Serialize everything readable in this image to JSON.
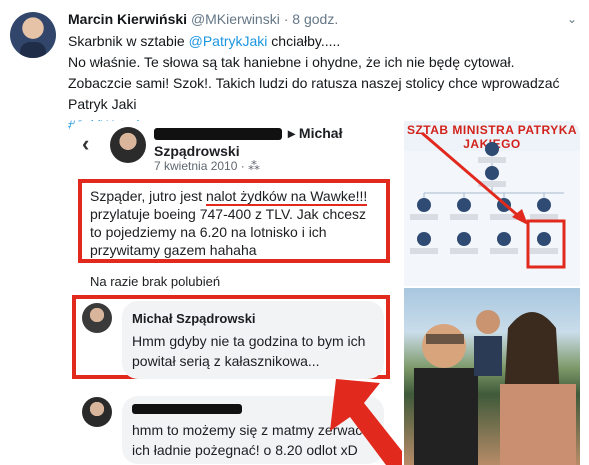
{
  "tweet": {
    "name": "Marcin Kierwiński",
    "handle": "@MKierwinski",
    "separator": "·",
    "time": "8 godz.",
    "line1_prefix": "Skarbnik w sztabie ",
    "line1_mention": "@PatrykJaki",
    "line1_suffix": " chciałby.....",
    "line2": "No właśnie. Te słowa są tak haniebne i ohydne, że ich nie będę cytował. Zobaczcie sami! Szok!. Takich ludzi do ratusza naszej stolicy chce wprowadzać Patryk Jaki",
    "hashtag": "#JakiWstyd"
  },
  "fb": {
    "author_suffix": "▸ Michał Szpądrowski",
    "date": "7 kwietnia 2010 · ⁂",
    "post_before": "Szpąder, jutro jest ",
    "post_underlined": "nalot żydków na Wawke!!!",
    "post_after": " przylatuje boeing 747-400 z TLV. Jak chcesz to pojedziemy na 6.20 na lotnisko i ich przywitamy gazem hahaha",
    "likes": "Na razie brak polubień",
    "comment1_name": "Michał Szpądrowski",
    "comment1_text": "Hmm gdyby nie ta godzina to bym ich powitał serią z kałasznikowa...",
    "comment2_text": "hmm to możemy się z matmy zerwać i ich ładnie pożegnać! o 8.20 odlot xD"
  },
  "chart_image": {
    "title": "SZTAB MINISTRA PATRYKA JAKIEGO"
  },
  "colors": {
    "link": "#1b95e0",
    "highlight": "#e1291e"
  }
}
